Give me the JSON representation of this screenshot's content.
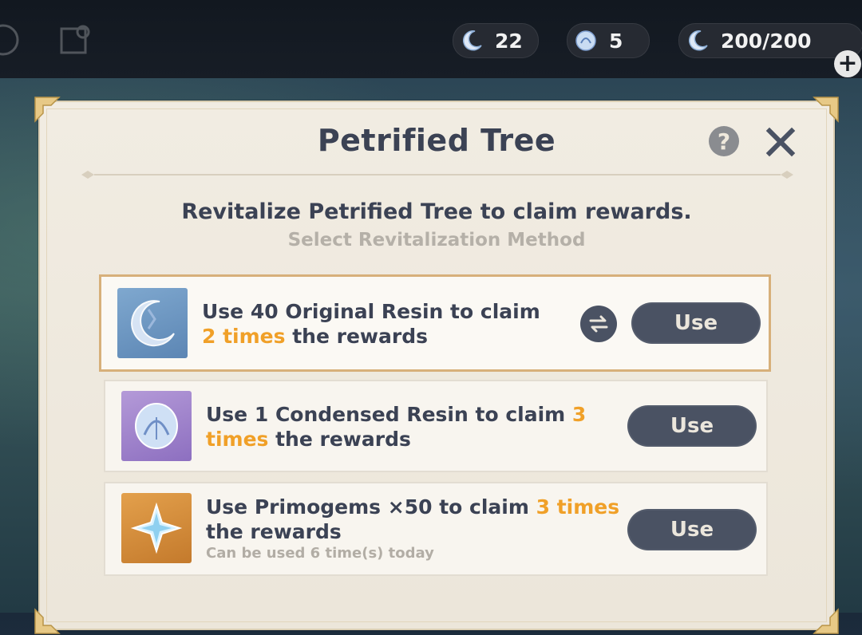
{
  "topbar": {
    "currencies": [
      {
        "icon": "fragile-resin-icon",
        "value": "22"
      },
      {
        "icon": "condensed-resin-icon",
        "value": "5"
      },
      {
        "icon": "original-resin-icon",
        "value": "200/200"
      }
    ],
    "plus_label": "+"
  },
  "dialog": {
    "title": "Petrified Tree",
    "help_label": "?",
    "subtitle": "Revitalize Petrified Tree to claim rewards.",
    "subtitle2": "Select Revitalization Method",
    "options": [
      {
        "icon": "original-resin-icon",
        "text_pre": "Use 40 Original Resin to claim ",
        "text_hl": "2 times",
        "text_post": " the rewards",
        "note": "",
        "button": "Use",
        "selected": true
      },
      {
        "icon": "condensed-resin-icon",
        "text_pre": "Use 1 Condensed Resin to claim ",
        "text_hl": "3 times",
        "text_post": " the rewards",
        "note": "",
        "button": "Use",
        "selected": false
      },
      {
        "icon": "primogem-icon",
        "text_pre": "Use Primogems ×50 to claim ",
        "text_hl": "3 times",
        "text_post": " the rewards",
        "note": "Can be used 6 time(s) today",
        "button": "Use",
        "selected": false
      }
    ]
  },
  "colors": {
    "highlight": "#f0a028",
    "button_bg": "#4a5263",
    "panel_bg": "#f1ece2",
    "selected_border": "#d7b07a"
  }
}
